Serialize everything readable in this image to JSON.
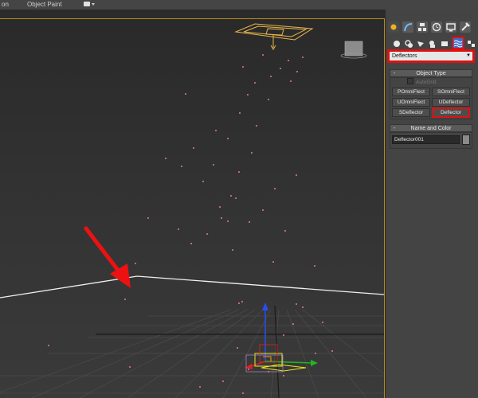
{
  "menubar": {
    "items": [
      "on",
      "Object Paint"
    ]
  },
  "command_panel": {
    "tabs": [
      "create-tab",
      "modify-tab",
      "hierarchy-tab",
      "motion-tab",
      "display-tab",
      "utilities-tab"
    ],
    "categories": [
      "geometry",
      "shapes",
      "lights",
      "cameras",
      "helpers",
      "space-warps",
      "systems"
    ],
    "selected_category": "space-warps",
    "dropdown_value": "Deflectors",
    "object_type": {
      "title": "Object Type",
      "autogrid_label": "AutoGrid",
      "buttons": [
        "POmniFlect",
        "SOmniFlect",
        "UOmniFlect",
        "UDeflector",
        "SDeflector",
        "Deflector"
      ],
      "selected_button": "Deflector"
    },
    "name_and_color": {
      "title": "Name and Color",
      "name_value": "Deflector001"
    },
    "rollout_collapse_symbol": "-"
  },
  "colors": {
    "highlight_red": "#dd1111",
    "viewport_frame": "#b88a1c",
    "particle": "#e07ca0",
    "deflector_line": "#f0f0f0"
  }
}
